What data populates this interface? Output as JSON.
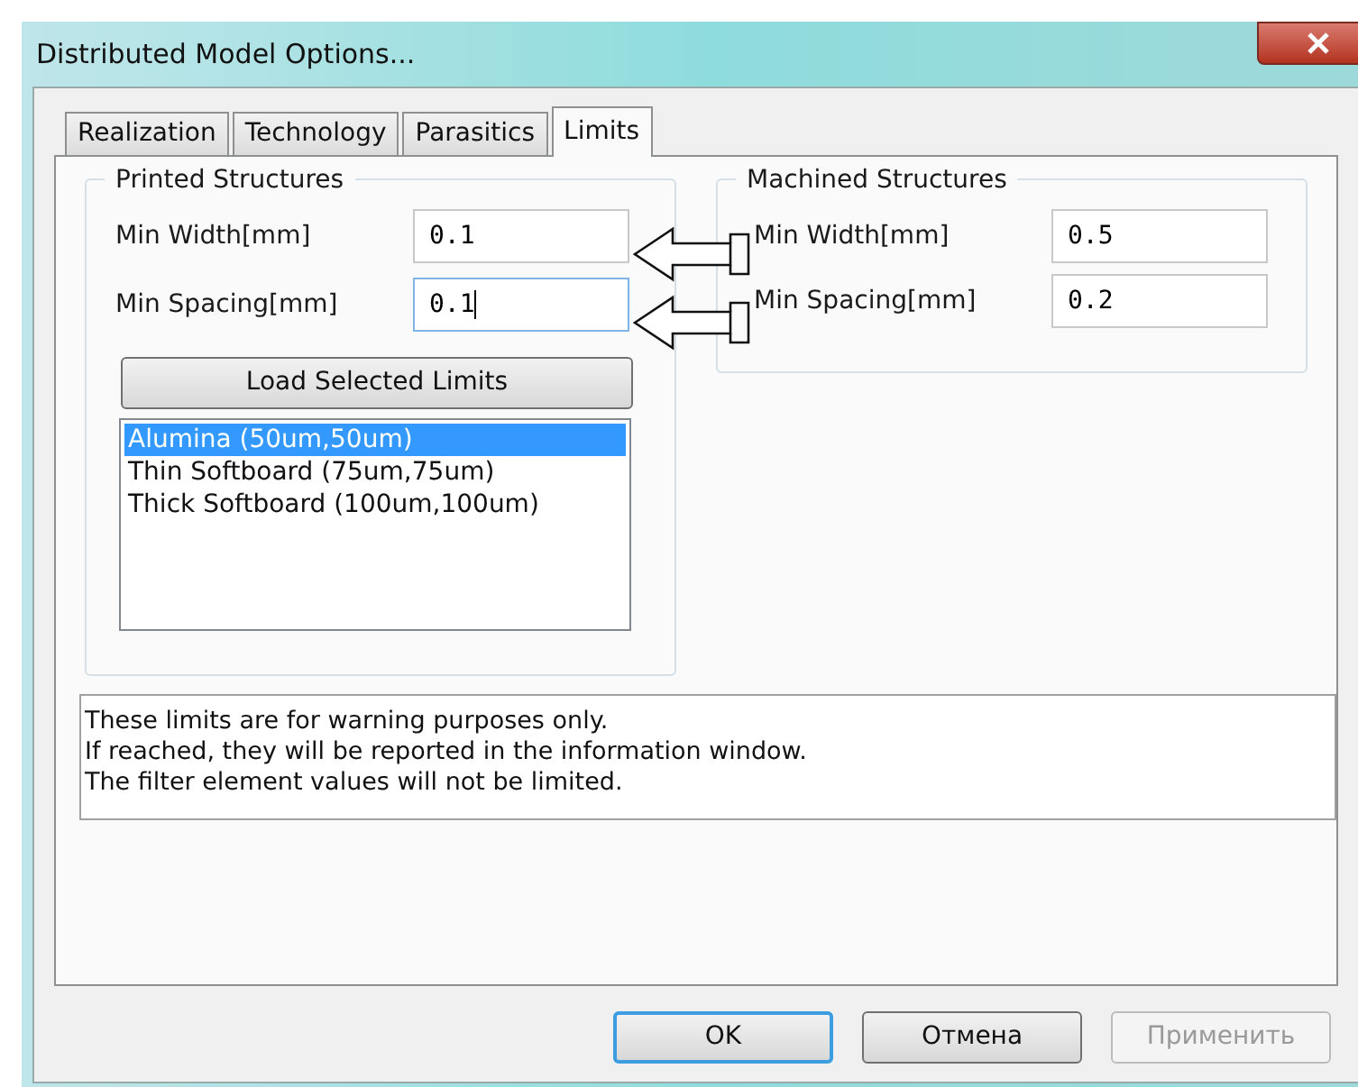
{
  "window": {
    "title": "Distributed Model Options..."
  },
  "tabs": [
    {
      "label": "Realization",
      "selected": false
    },
    {
      "label": "Technology",
      "selected": false
    },
    {
      "label": "Parasitics",
      "selected": false
    },
    {
      "label": "Limits",
      "selected": true
    }
  ],
  "printed_structures": {
    "title": "Printed Structures",
    "fields": [
      {
        "label": "Min Width[mm]",
        "value": "0.1",
        "focused": false
      },
      {
        "label": "Min Spacing[mm]",
        "value": "0.1",
        "focused": true
      }
    ],
    "load_button": "Load Selected Limits",
    "list": [
      {
        "label": "Alumina (50um,50um)",
        "selected": true
      },
      {
        "label": "Thin Softboard (75um,75um)",
        "selected": false
      },
      {
        "label": "Thick Softboard (100um,100um)",
        "selected": false
      }
    ]
  },
  "machined_structures": {
    "title": "Machined Structures",
    "fields": [
      {
        "label": "Min Width[mm]",
        "value": "0.5",
        "focused": false
      },
      {
        "label": "Min Spacing[mm]",
        "value": "0.2",
        "focused": false
      }
    ]
  },
  "info_lines": [
    "These limits are for warning purposes only.",
    "If reached, they will be reported in the information window.",
    "The filter element values will not be limited."
  ],
  "buttons": [
    {
      "label": "OK",
      "default": true,
      "disabled": false
    },
    {
      "label": "Отмена",
      "default": false,
      "disabled": false
    },
    {
      "label": "Применить",
      "default": false,
      "disabled": true
    }
  ]
}
